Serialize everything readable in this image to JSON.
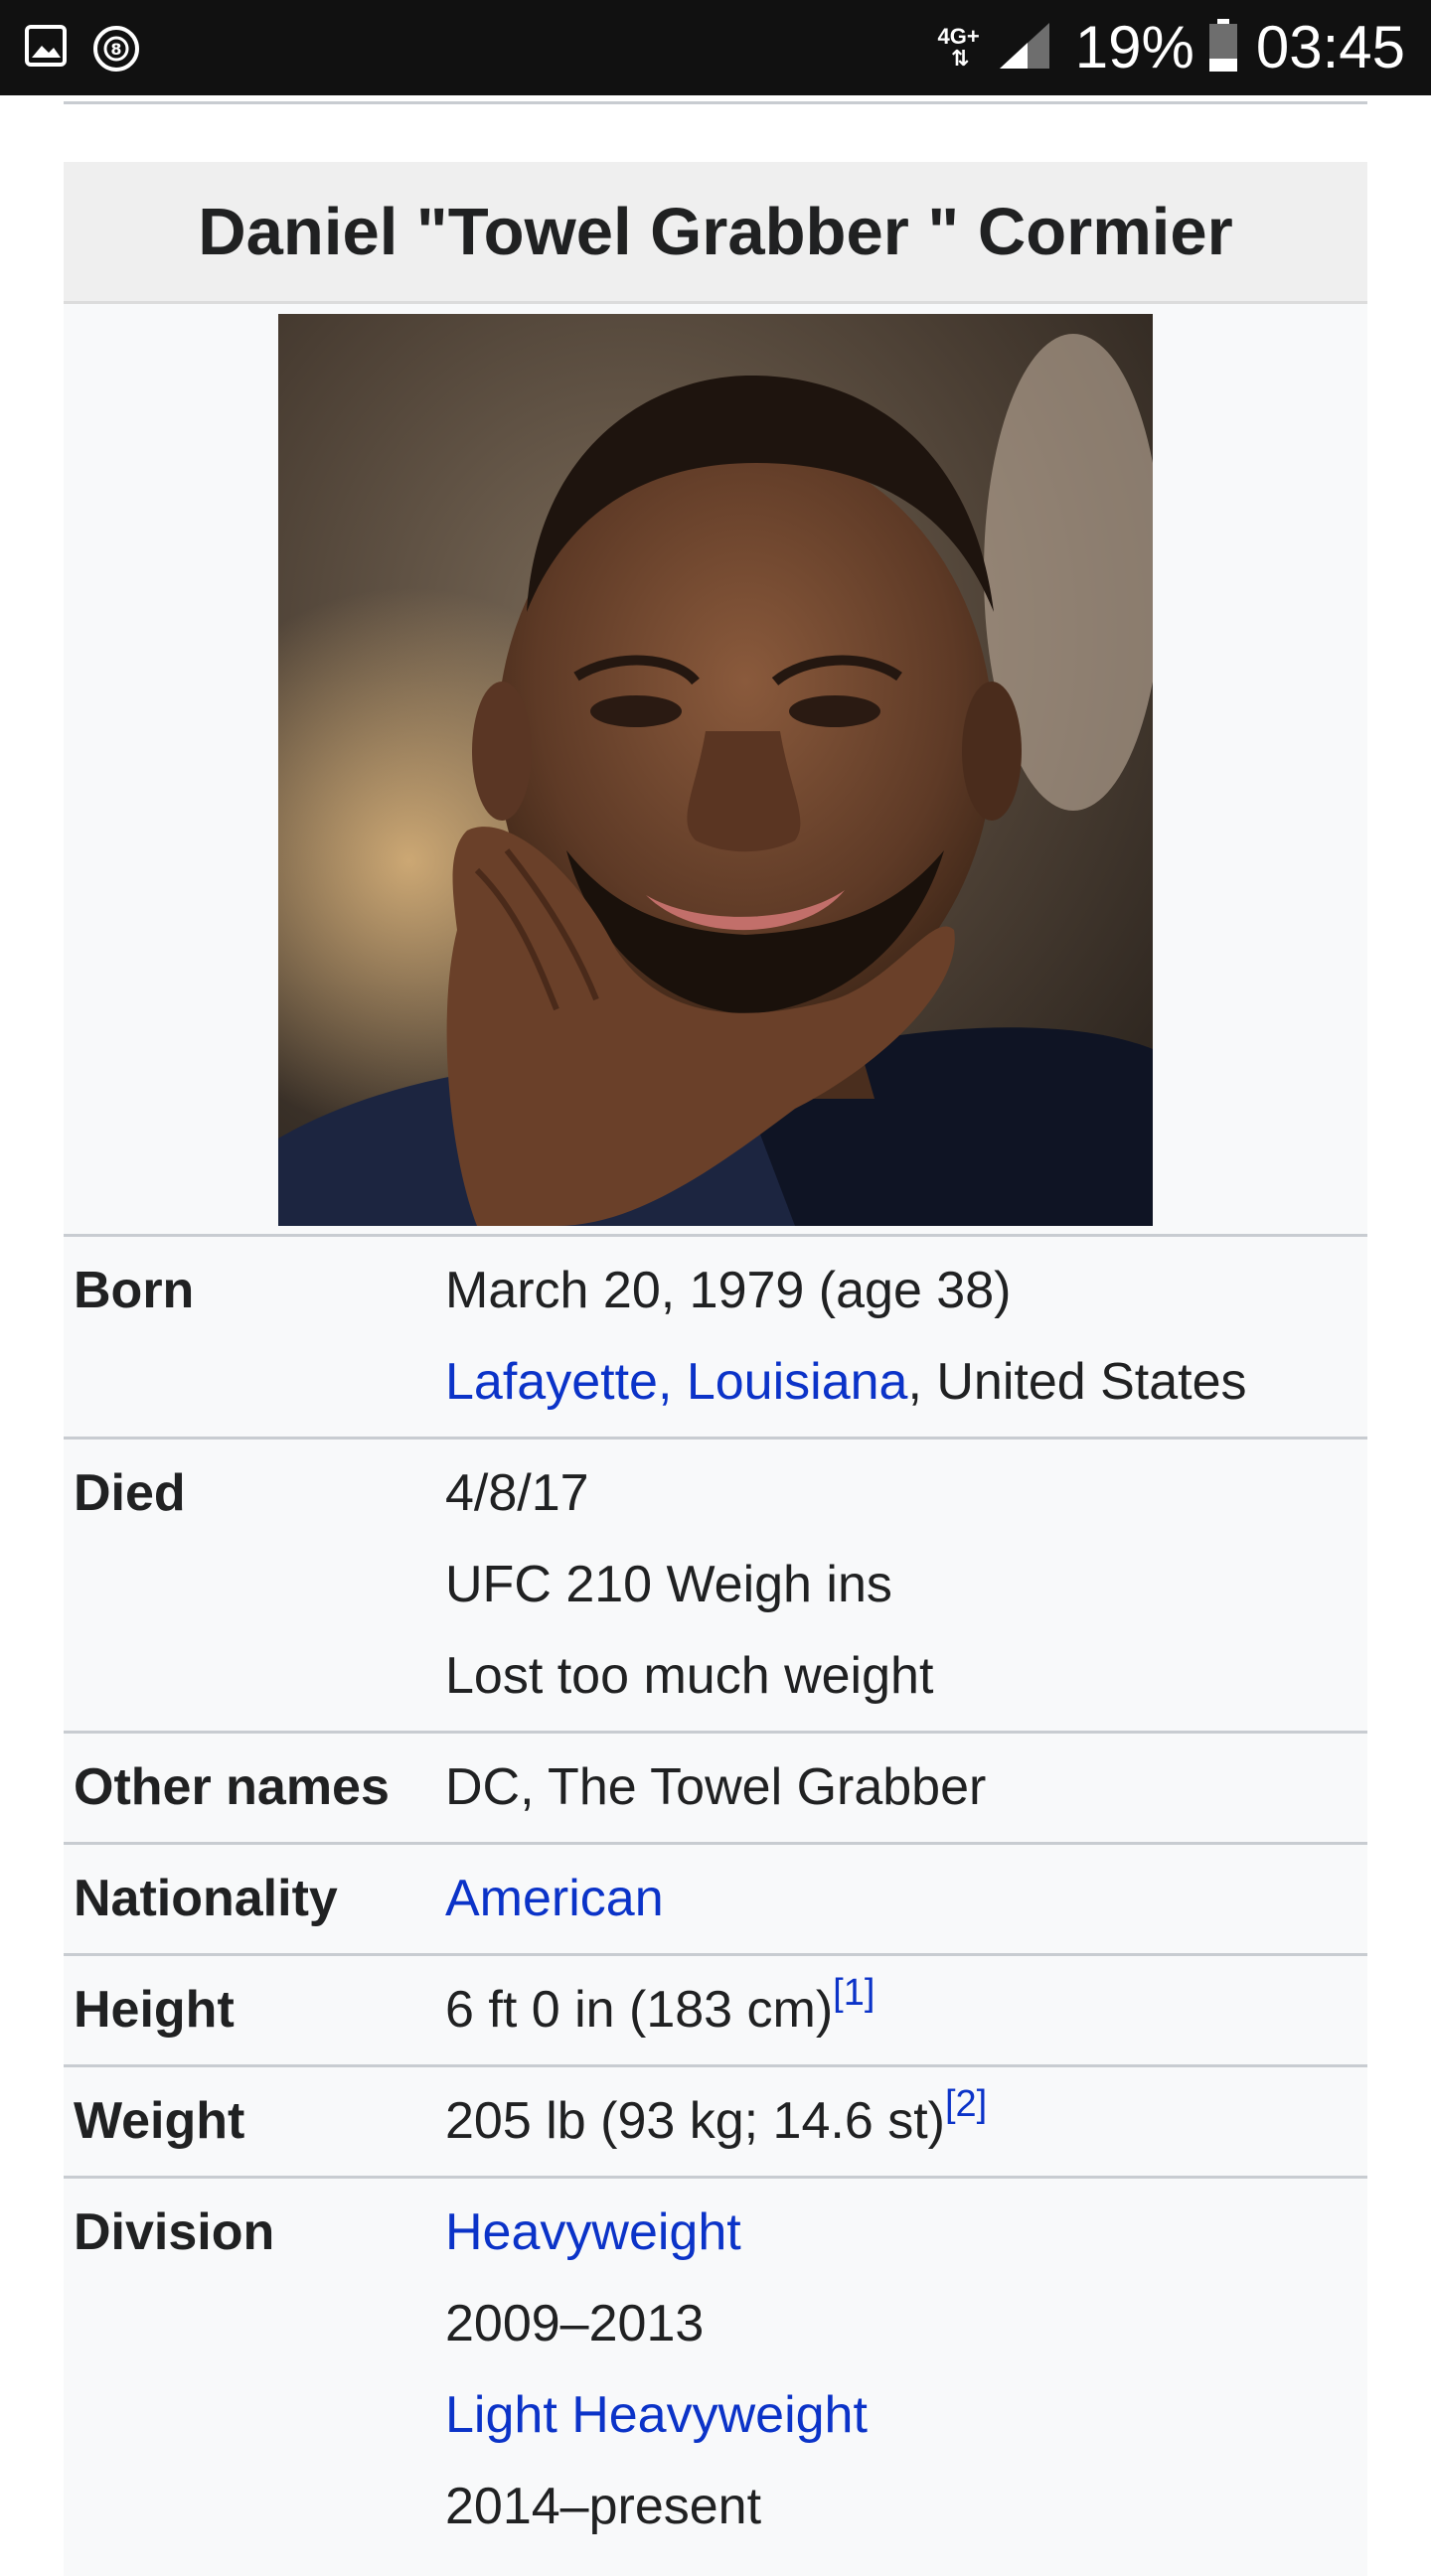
{
  "status_bar": {
    "network": "4G+",
    "battery": "19%",
    "time": "03:45"
  },
  "infobox": {
    "title": "Daniel \"Towel Grabber \" Cormier",
    "born": {
      "label": "Born",
      "date": "March 20, 1979 (age 38)",
      "place_link": "Lafayette, Louisiana",
      "place_rest": ", United States"
    },
    "died": {
      "label": "Died",
      "lines": [
        "4/8/17",
        "UFC 210 Weigh ins",
        "Lost too much weight"
      ]
    },
    "other_names": {
      "label": "Other names",
      "value": "DC, The Towel Grabber"
    },
    "nationality": {
      "label": "Nationality",
      "value": "American"
    },
    "height": {
      "label": "Height",
      "value": "6 ft 0 in (183 cm)",
      "ref": "[1]"
    },
    "weight": {
      "label": "Weight",
      "value": "205 lb (93 kg; 14.6 st)",
      "ref": "[2]"
    },
    "division": {
      "label": "Division",
      "entries": [
        {
          "name": "Heavyweight",
          "years": "2009–2013"
        },
        {
          "name": "Light Heavyweight",
          "years": "2014–present"
        }
      ]
    }
  },
  "icons": {
    "gallery": "image-icon",
    "notification": "circle-badge-icon",
    "signal": "signal-icon",
    "battery": "battery-icon"
  }
}
